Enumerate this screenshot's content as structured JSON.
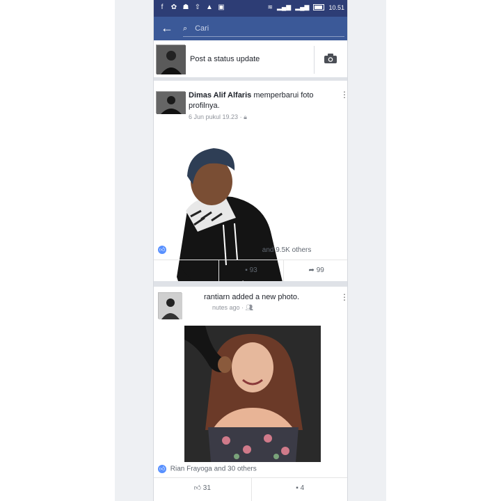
{
  "status_bar": {
    "time": "10.51",
    "icons": [
      "facebook-icon",
      "app-icon",
      "app-icon-2",
      "upload-icon",
      "app-icon-3",
      "message-icon"
    ],
    "signal": "wifi + signal"
  },
  "app_bar": {
    "search_placeholder": "Cari"
  },
  "composer": {
    "prompt": "Post a status update"
  },
  "posts": [
    {
      "author": "Dimas Alif Alfaris",
      "action": "memperbarui foto profilnya.",
      "time": "6 Jun pukul 19.23",
      "reactions": "and 9.5K others",
      "comments": "93",
      "shares": "99"
    },
    {
      "author_partial": "rantiarn",
      "action": "added a new photo.",
      "time": "nutes ago",
      "reactions": "Rian Frayoga and 30 others",
      "likes": "31",
      "comments": "4"
    }
  ],
  "colors": {
    "facebook_blue": "#3b5998",
    "status_bar": "#2d3d75",
    "like_blue": "#5890ff"
  }
}
